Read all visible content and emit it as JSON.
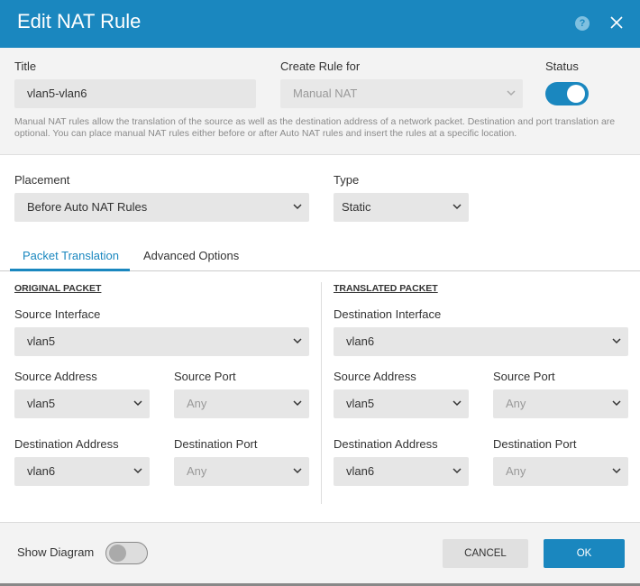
{
  "dialog": {
    "title": "Edit NAT Rule",
    "help_glyph": "?"
  },
  "top": {
    "title_label": "Title",
    "title_value": "vlan5-vlan6",
    "create_rule_label": "Create Rule for",
    "create_rule_value": "Manual NAT",
    "status_label": "Status",
    "status_on": true,
    "description": "Manual NAT rules allow the translation of the source as well as the destination address of a network packet. Destination and port translation are optional. You can place manual NAT rules either before or after Auto NAT rules and insert the rules at a specific location."
  },
  "placement": {
    "label": "Placement",
    "value": "Before Auto NAT Rules"
  },
  "type": {
    "label": "Type",
    "value": "Static"
  },
  "tabs": [
    {
      "label": "Packet Translation",
      "active": true
    },
    {
      "label": "Advanced Options",
      "active": false
    }
  ],
  "original": {
    "heading": "ORIGINAL PACKET",
    "source_interface_label": "Source Interface",
    "source_interface_value": "vlan5",
    "source_address_label": "Source Address",
    "source_address_value": "vlan5",
    "source_port_label": "Source Port",
    "source_port_value": "Any",
    "dest_address_label": "Destination Address",
    "dest_address_value": "vlan6",
    "dest_port_label": "Destination Port",
    "dest_port_value": "Any"
  },
  "translated": {
    "heading": "TRANSLATED PACKET",
    "dest_interface_label": "Destination Interface",
    "dest_interface_value": "vlan6",
    "source_address_label": "Source Address",
    "source_address_value": "vlan5",
    "source_port_label": "Source Port",
    "source_port_value": "Any",
    "dest_address_label": "Destination Address",
    "dest_address_value": "vlan6",
    "dest_port_label": "Destination Port",
    "dest_port_value": "Any"
  },
  "footer": {
    "show_diagram_label": "Show Diagram",
    "show_diagram_on": false,
    "cancel_label": "CANCEL",
    "ok_label": "OK"
  },
  "colors": {
    "accent": "#1a87bf",
    "field_bg": "#e6e6e6",
    "panel_bg": "#f3f3f3"
  }
}
